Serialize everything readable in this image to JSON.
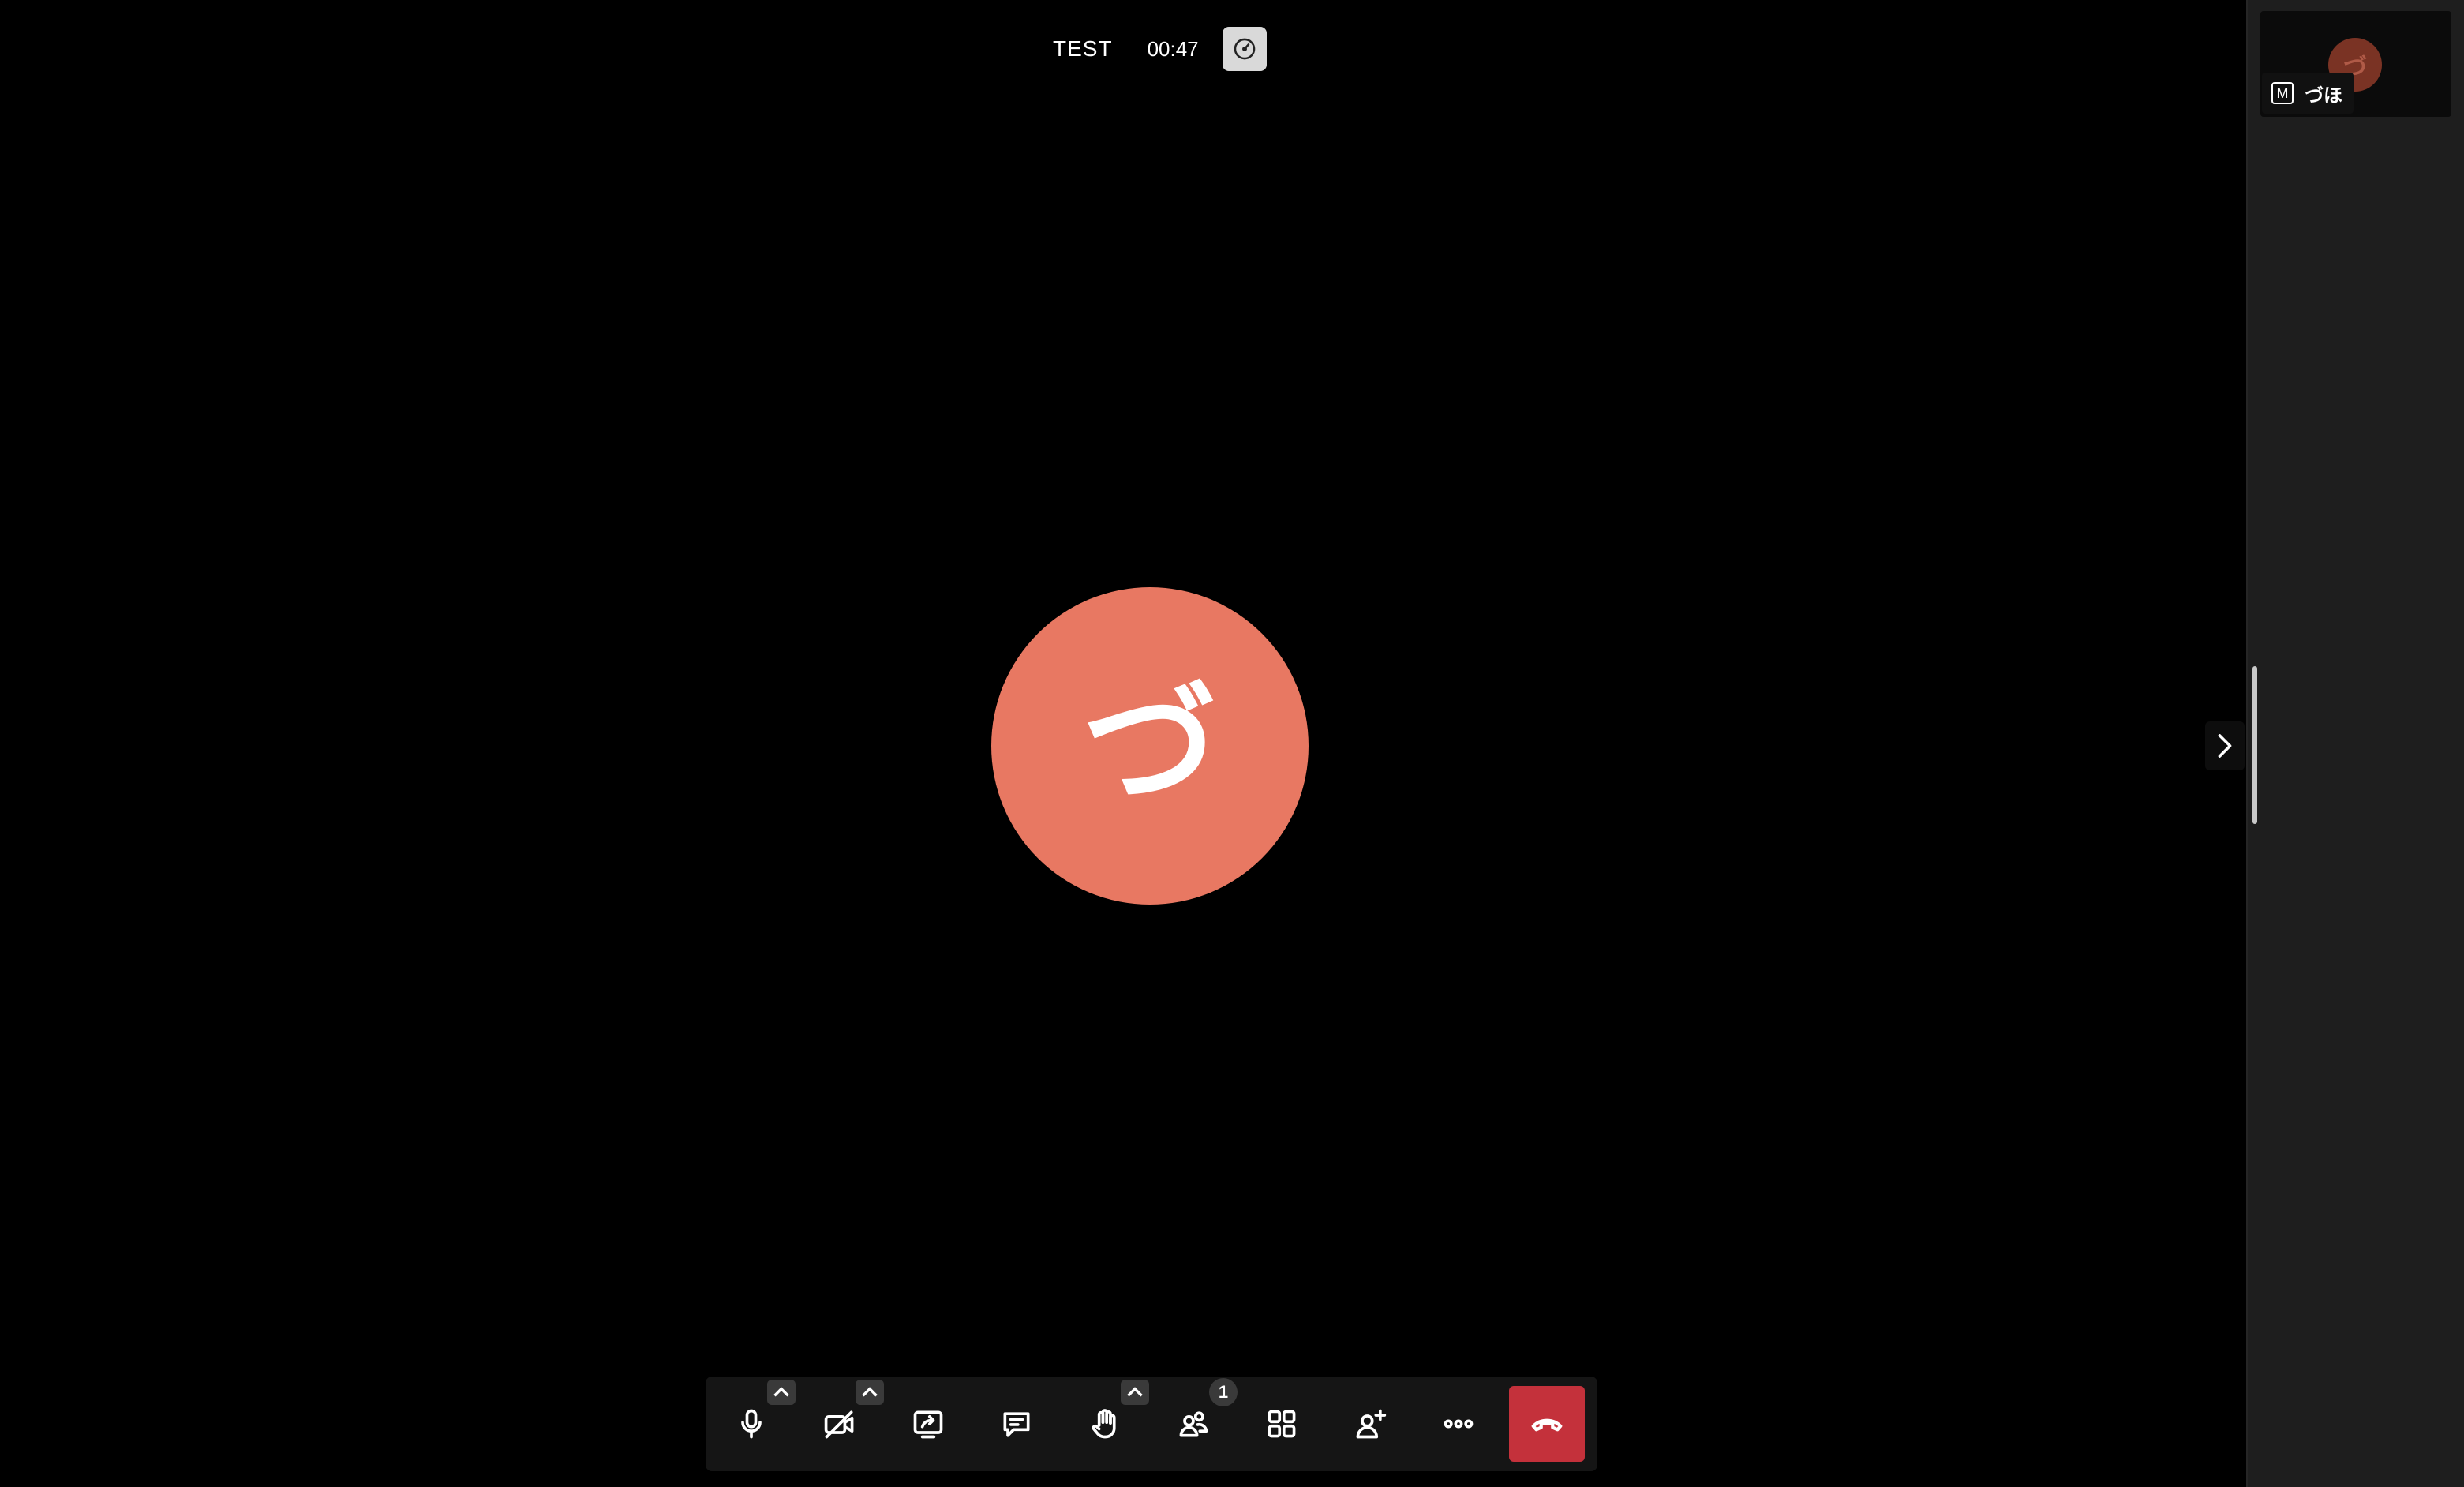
{
  "meeting": {
    "title": "TEST",
    "elapsed": "00:47"
  },
  "main_participant": {
    "avatar_initial": "づ",
    "avatar_color": "#e87862"
  },
  "side_panel": {
    "self_tile": {
      "name": "づほ",
      "mute_badge": "M",
      "avatar_initial": "づ",
      "avatar_color": "#7a3324"
    }
  },
  "toolbar": {
    "buttons": [
      {
        "name": "microphone",
        "icon": "microphone-icon",
        "has_menu": true
      },
      {
        "name": "camera",
        "icon": "camera-off-icon",
        "has_menu": true
      },
      {
        "name": "share-screen",
        "icon": "screen-share-icon",
        "has_menu": false
      },
      {
        "name": "chat",
        "icon": "chat-bubble-icon",
        "has_menu": false
      },
      {
        "name": "raise-hand",
        "icon": "hand-icon",
        "has_menu": true
      },
      {
        "name": "participants",
        "icon": "people-icon",
        "has_menu": false
      },
      {
        "name": "tile-view",
        "icon": "grid-icon",
        "has_menu": false
      },
      {
        "name": "invite",
        "icon": "add-person-icon",
        "has_menu": false
      },
      {
        "name": "more",
        "icon": "more-dots-icon",
        "has_menu": false
      },
      {
        "name": "leave",
        "icon": "hang-up-icon",
        "has_menu": false
      }
    ],
    "participant_count": "1",
    "leave_color": "#c4313b"
  }
}
